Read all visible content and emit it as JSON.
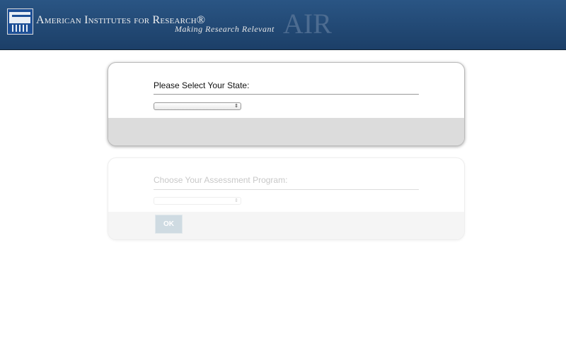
{
  "header": {
    "org_name": "American Institutes for Research®",
    "tagline": "Making Research Relevant",
    "logo_mark": "AIR"
  },
  "state_panel": {
    "label": "Please Select Your State:",
    "selected": ""
  },
  "program_panel": {
    "label": "Choose Your Assessment Program:",
    "selected": "",
    "ok_label": "OK"
  }
}
